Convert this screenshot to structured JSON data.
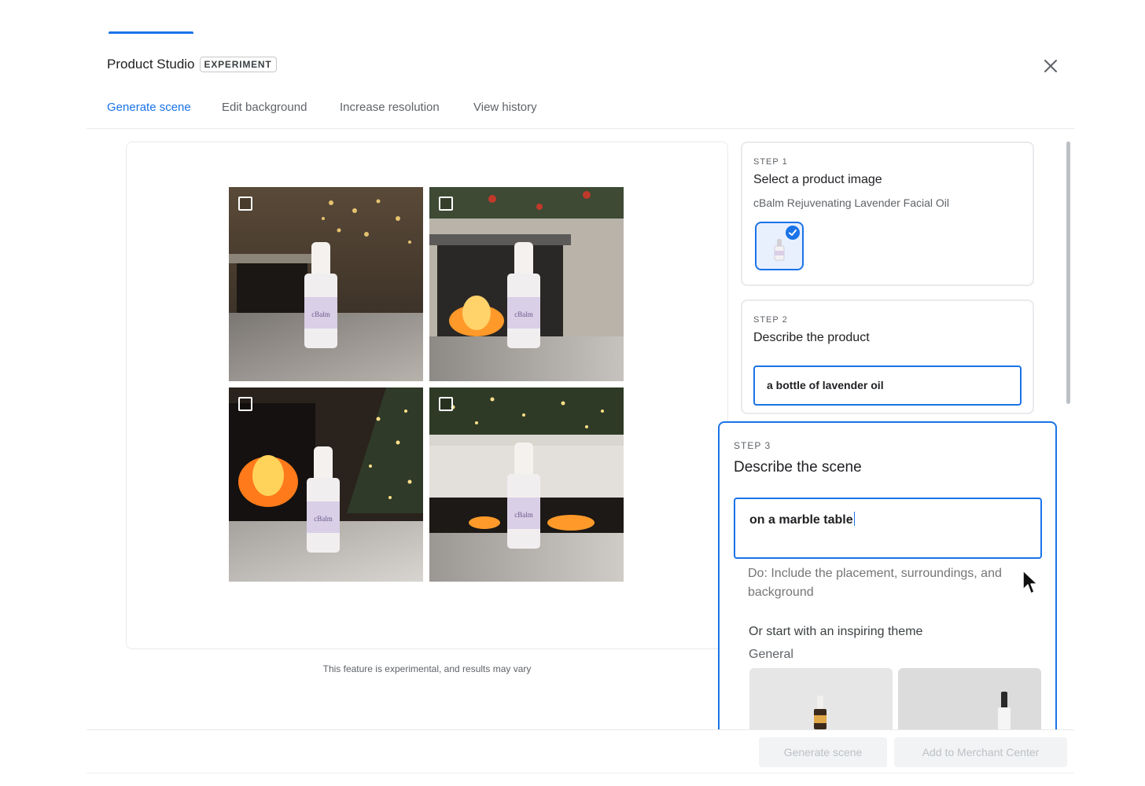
{
  "header": {
    "title": "Product Studio",
    "badge": "EXPERIMENT"
  },
  "tabs": [
    {
      "label": "Generate scene",
      "active": true
    },
    {
      "label": "Edit background",
      "active": false
    },
    {
      "label": "Increase resolution",
      "active": false
    },
    {
      "label": "View history",
      "active": false
    }
  ],
  "preview": {
    "disclaimer": "This feature is experimental, and results may vary",
    "images": [
      {
        "name": "scene-image-1",
        "checked": false
      },
      {
        "name": "scene-image-2",
        "checked": false
      },
      {
        "name": "scene-image-3",
        "checked": false
      },
      {
        "name": "scene-image-4",
        "checked": false
      }
    ]
  },
  "step1": {
    "label": "STEP 1",
    "title": "Select a product image",
    "product_name": "cBalm Rejuvenating Lavender Facial Oil",
    "thumbnail_selected": true
  },
  "step2": {
    "label": "STEP 2",
    "title": "Describe the product",
    "input_value": "a bottle of lavender oil"
  },
  "step3": {
    "label": "STEP 3",
    "title": "Describe the scene",
    "input_value": "on a marble table",
    "hint": "Do: Include the placement, surroundings, and background",
    "theme_title": "Or start with an inspiring theme",
    "theme_category": "General"
  },
  "footer": {
    "generate_label": "Generate scene",
    "add_label": "Add to Merchant Center"
  },
  "colors": {
    "accent": "#1a73e8",
    "label_dark": "#6a5a8f"
  }
}
